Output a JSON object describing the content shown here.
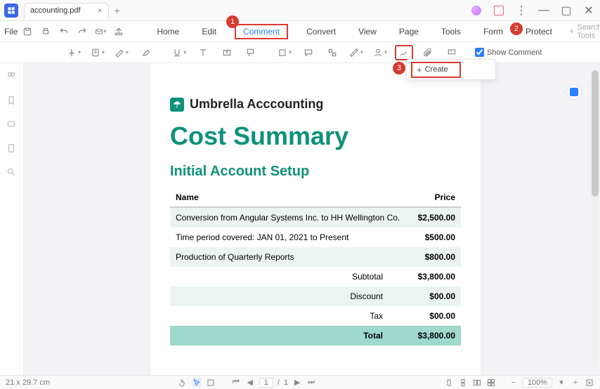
{
  "titlebar": {
    "tab_name": "accounting.pdf"
  },
  "menu": {
    "file": "File",
    "items": [
      "Home",
      "Edit",
      "Comment",
      "Convert",
      "View",
      "Page",
      "Tools",
      "Form",
      "Protect"
    ],
    "active_index": 2,
    "search_placeholder": "Search Tools"
  },
  "toolbar": {
    "show_comment_label": "Show Comment"
  },
  "callouts": {
    "one": "1",
    "two": "2",
    "three": "3"
  },
  "dropdown": {
    "create": "Create"
  },
  "document": {
    "brand": "Umbrella Acccounting",
    "title": "Cost Summary",
    "section": "Initial Account Setup",
    "columns": {
      "name": "Name",
      "price": "Price"
    },
    "rows": [
      {
        "name": "Conversion from Angular Systems Inc. to HH Wellington Co.",
        "price": "$2,500.00"
      },
      {
        "name": "Time period covered: JAN 01, 2021 to Present",
        "price": "$500.00"
      },
      {
        "name": "Production of Quarterly Reports",
        "price": "$800.00"
      }
    ],
    "summary": [
      {
        "label": "Subtotal",
        "value": "$3,800.00"
      },
      {
        "label": "Discount",
        "value": "$00.00"
      },
      {
        "label": "Tax",
        "value": "$00.00"
      },
      {
        "label": "Total",
        "value": "$3,800.00"
      }
    ]
  },
  "status": {
    "page_size": "21 x 29.7 cm",
    "page": "1",
    "page_sep": "/",
    "pages_total": "1",
    "zoom": "100%"
  }
}
